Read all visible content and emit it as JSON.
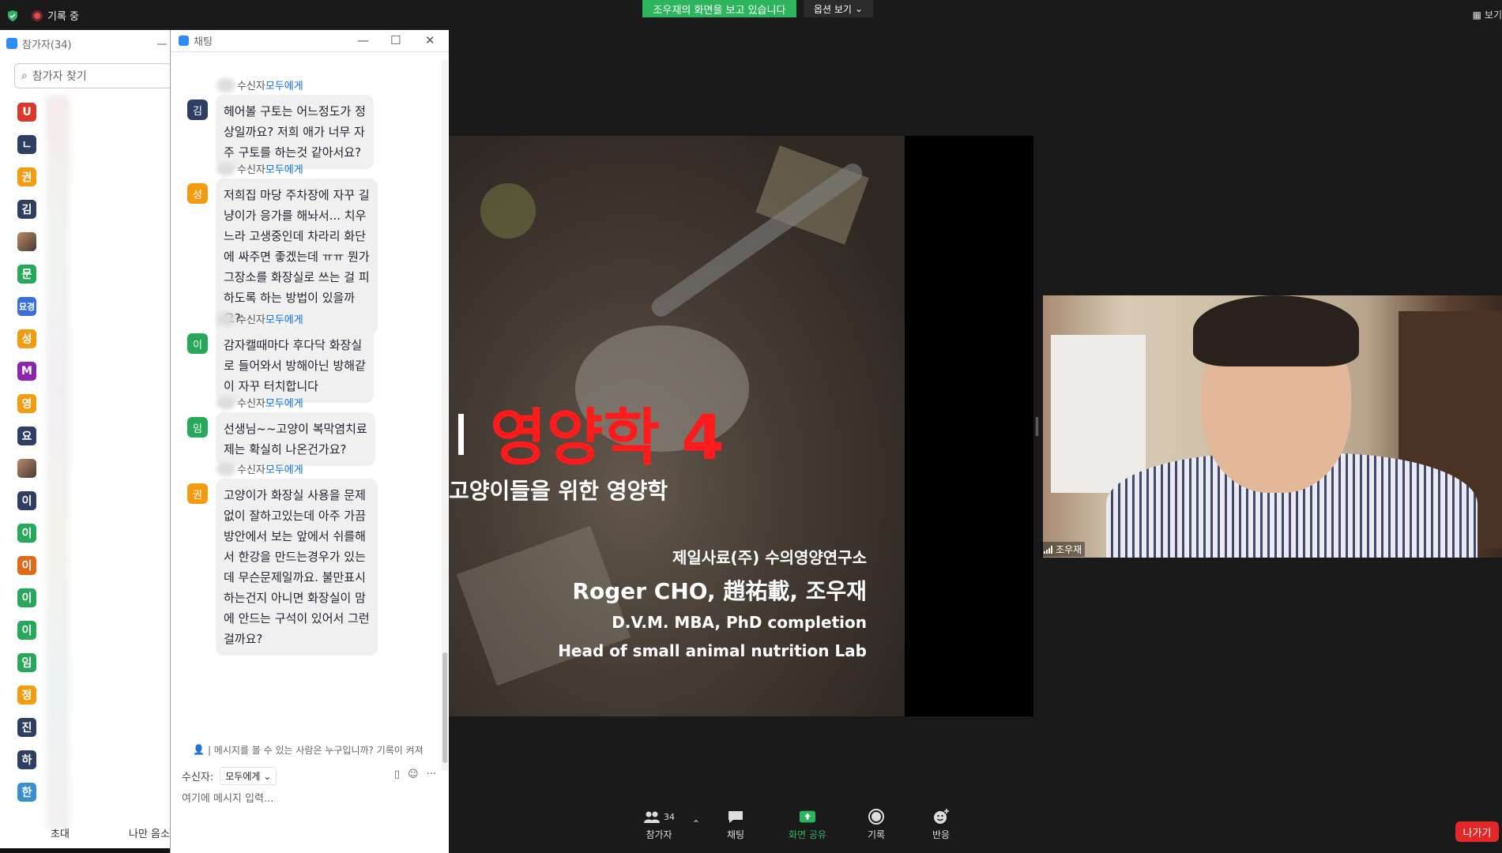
{
  "top": {
    "recording": "기록 중",
    "share_banner": "조우재의 화면을 보고 있습니다",
    "view_options": "옵션 보기",
    "view_right": "보기"
  },
  "participants": {
    "title": "참가자(34)",
    "search_placeholder": "참가자 찾기",
    "items": [
      {
        "initial": "U",
        "color": "#d9382c"
      },
      {
        "initial": "ㄴ",
        "color": "#2f3f63"
      },
      {
        "initial": "권",
        "color": "#f39c12"
      },
      {
        "initial": "김",
        "color": "#2f3f63"
      },
      {
        "initial": "",
        "color": "#8b6a55",
        "photo": true
      },
      {
        "initial": "문",
        "color": "#27a85a"
      },
      {
        "initial": "묘경",
        "color": "#3a6fd8"
      },
      {
        "initial": "성",
        "color": "#f39c12"
      },
      {
        "initial": "M",
        "color": "#8e24aa"
      },
      {
        "initial": "영",
        "color": "#f39c12"
      },
      {
        "initial": "요",
        "color": "#2f3f63"
      },
      {
        "initial": "",
        "color": "#3a4e7a",
        "photo": true
      },
      {
        "initial": "이",
        "color": "#2f3f63"
      },
      {
        "initial": "이",
        "color": "#27a85a"
      },
      {
        "initial": "이",
        "color": "#e06a1b"
      },
      {
        "initial": "이",
        "color": "#27a85a"
      },
      {
        "initial": "이",
        "color": "#27a85a"
      },
      {
        "initial": "임",
        "color": "#27a85a"
      },
      {
        "initial": "정",
        "color": "#f39c12"
      },
      {
        "initial": "진",
        "color": "#2f3f63"
      },
      {
        "initial": "하",
        "color": "#2f3f63"
      },
      {
        "initial": "한",
        "color": "#3a8fd0"
      }
    ],
    "invite": "초대",
    "mute_self": "나만 음소"
  },
  "chat": {
    "title": "채팅",
    "messages": [
      {
        "sender_label": "수신자",
        "to": "모두에게",
        "initial": "김",
        "color": "#2f3f63",
        "lines": [
          "헤어볼 구토는 어느정도가 정",
          "상일까요? 저희 애가 너무 자",
          "주 구토를 하는것 같아서요?"
        ]
      },
      {
        "sender_label": "수신자",
        "to": "모두에게",
        "initial": "성",
        "color": "#f39c12",
        "lines": [
          "저희집 마당 주차장에 자꾸 길",
          "냥이가 응가를 해놔서... 치우",
          "느라 고생중인데 차라리 화단",
          "에 싸주면 좋겠는데 ㅠㅠ 뭔가",
          "그장소를 화장실로 쓰는 걸 피",
          "하도록 하는 방법이 있을까",
          "요?"
        ]
      },
      {
        "sender_label": "수신자",
        "to": "모두에게",
        "initial": "이",
        "color": "#27a85a",
        "lines": [
          "감자캘때마다 후다닥 화장실",
          "로 들어와서 방해아닌 방해같",
          "이 자꾸 터치합니다"
        ]
      },
      {
        "sender_label": "수신자",
        "to": "모두에게",
        "initial": "임",
        "color": "#27a85a",
        "lines": [
          "선생님~~고양이 복막염치료",
          "제는 확실히 나온건가요?"
        ]
      },
      {
        "sender_label": "수신자",
        "to": "모두에게",
        "initial": "권",
        "color": "#f39c12",
        "lines": [
          "고양이가 화장실 사용을 문제",
          "없이 잘하고있는데 아주 가끔",
          "방안에서 보는 앞에서 쉬를해",
          "서 한강을 만드는경우가 있는",
          "데 무슨문제일까요. 불만표시",
          "하는건지 아니면 화장실이 맘",
          "에 안드는 구석이 있어서 그런",
          "걸까요?"
        ]
      }
    ],
    "privacy_note": "| 메시지를 볼 수 있는 사람은 누구입니까? 기록이 켜져",
    "to_label": "수신자:",
    "to_value": "모두에게",
    "input_placeholder": "여기에 메시지 입력..."
  },
  "slide": {
    "title": "영양학 4",
    "subtitle": "고양이들을 위한 영양학",
    "org": "제일사료(주) 수의영양연구소",
    "name": "Roger CHO, 趙祐載, 조우재",
    "degree": "D.V.M. MBA, PhD completion",
    "lab": "Head of small animal nutrition Lab"
  },
  "video": {
    "name": "조우재"
  },
  "toolbar": {
    "participants_count": "34",
    "participants": "참가자",
    "chat": "채팅",
    "share": "화면 공유",
    "record": "기록",
    "reactions": "반응",
    "leave": "나가기"
  },
  "colors": {
    "share_green": "#2db55d",
    "link_blue": "#0e71eb",
    "title_red": "#ff1b1b",
    "leave_red": "#e02828"
  }
}
